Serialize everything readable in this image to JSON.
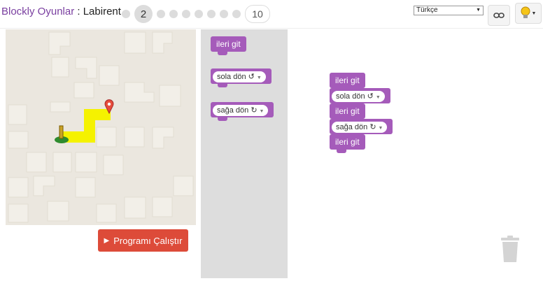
{
  "header": {
    "app_name": "Blockly Oyunlar",
    "separator": " : ",
    "game_name": "Labirent",
    "current_level": "2",
    "last_level": "10",
    "language": "Türkçe"
  },
  "toolbox": {
    "move_forward": "ileri git",
    "turn_left": "sola dön ↺",
    "turn_right": "sağa dön ↻"
  },
  "workspace": {
    "program": [
      "ileri git",
      "sola dön ↺",
      "ileri git",
      "sağa dön ↻",
      "ileri git"
    ]
  },
  "run_button": {
    "label": "Programı Çalıştır"
  },
  "colors": {
    "block": "#a55bba",
    "run_button": "#dd4b39",
    "path": "#f5f200",
    "toolbox": "#dddddd"
  }
}
